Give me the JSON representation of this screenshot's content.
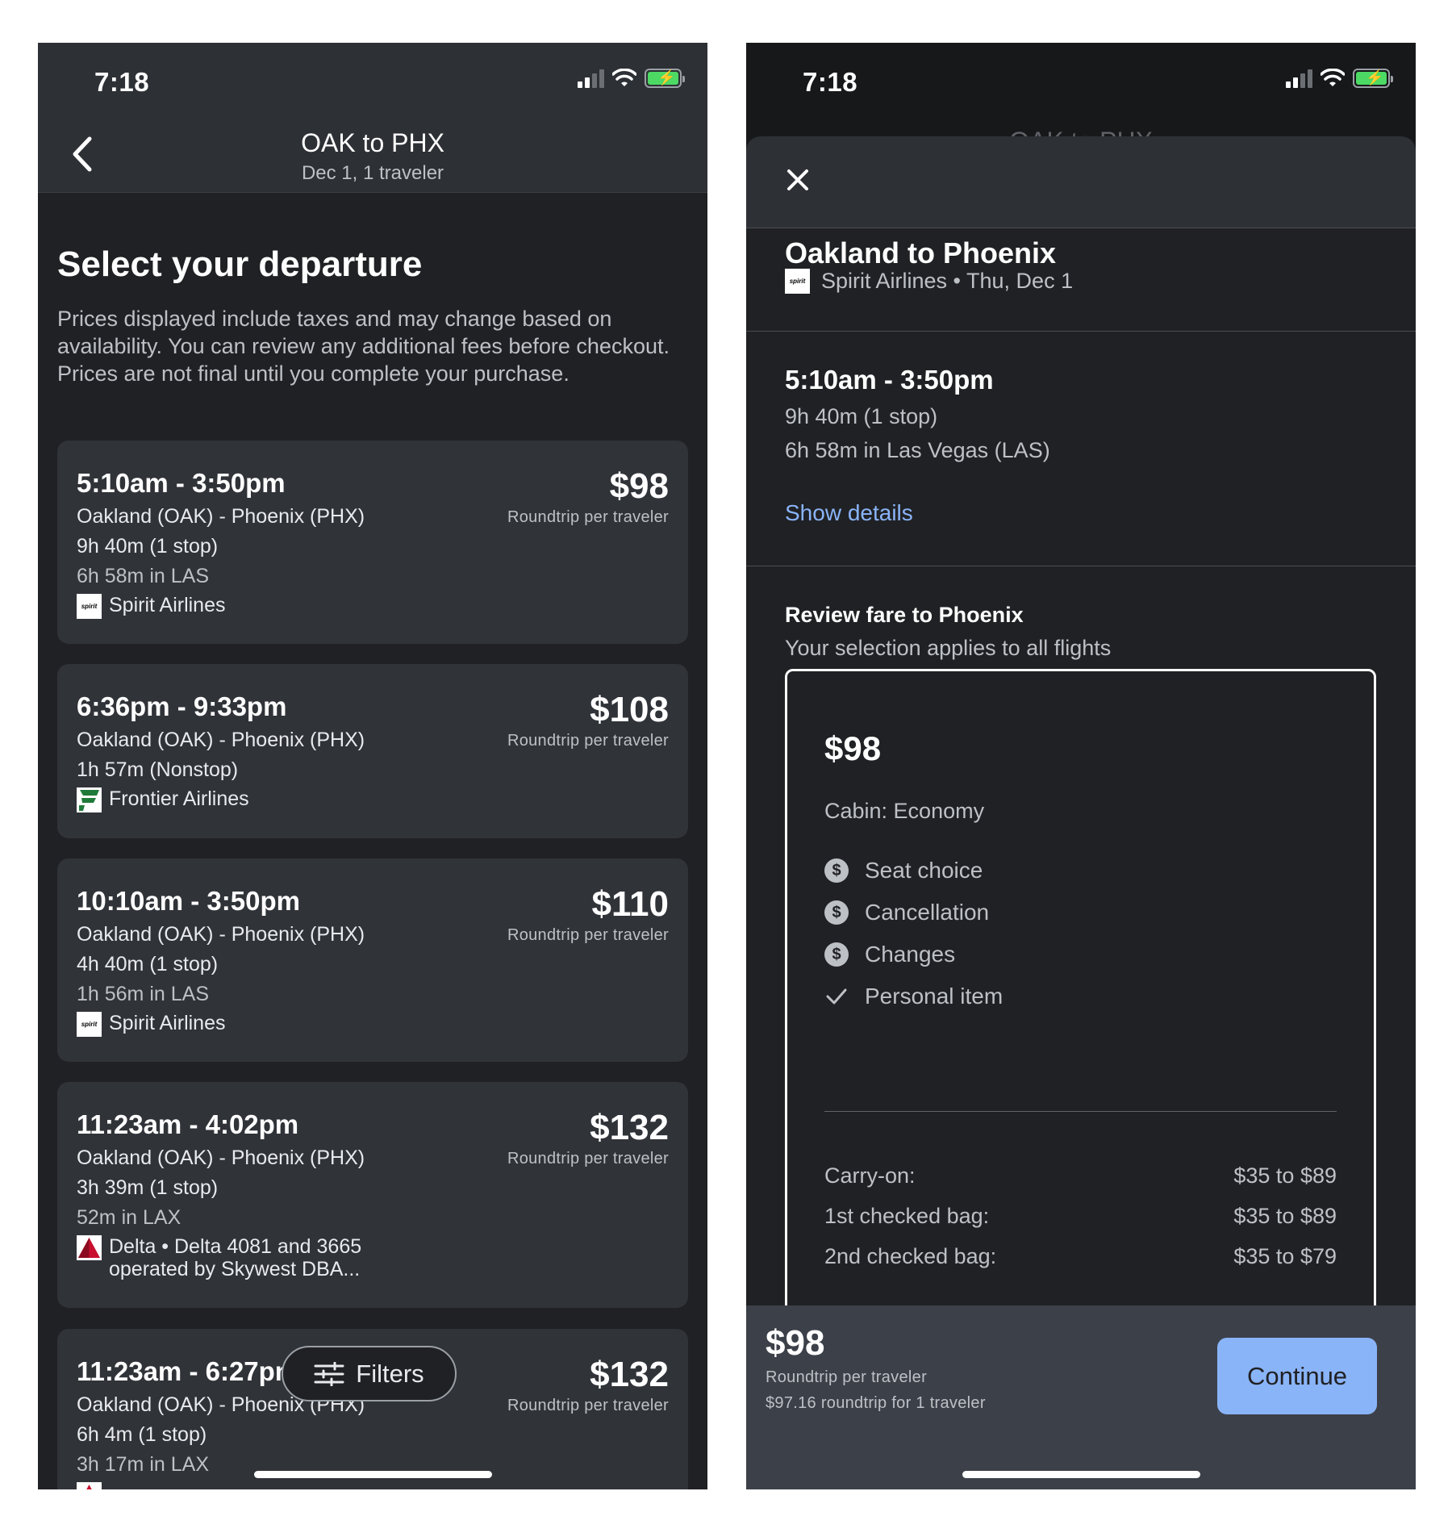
{
  "status_bar": {
    "time": "7:18"
  },
  "left": {
    "header": {
      "title": "OAK to PHX",
      "subtitle": "Dec 1, 1 traveler"
    },
    "heading": "Select your departure",
    "disclaimer": "Prices displayed include taxes and may change based on availability. You can review any additional fees before checkout. Prices are not final until you complete your purchase.",
    "flights": [
      {
        "time": "5:10am - 3:50pm",
        "route": "Oakland (OAK) - Phoenix (PHX)",
        "duration": "9h 40m (1 stop)",
        "layover": "6h 58m in LAS",
        "airline": "Spirit Airlines",
        "airline_detail": "",
        "logo": "spirit-logo",
        "price": "$98",
        "price_note": "Roundtrip per traveler"
      },
      {
        "time": "6:36pm - 9:33pm",
        "route": "Oakland (OAK) - Phoenix (PHX)",
        "duration": "1h 57m (Nonstop)",
        "layover": "",
        "airline": "Frontier Airlines",
        "airline_detail": "",
        "logo": "frontier-logo",
        "price": "$108",
        "price_note": "Roundtrip per traveler"
      },
      {
        "time": "10:10am - 3:50pm",
        "route": "Oakland (OAK) - Phoenix (PHX)",
        "duration": "4h 40m (1 stop)",
        "layover": "1h 56m in LAS",
        "airline": "Spirit Airlines",
        "airline_detail": "",
        "logo": "spirit-logo",
        "price": "$110",
        "price_note": "Roundtrip per traveler"
      },
      {
        "time": "11:23am - 4:02pm",
        "route": "Oakland (OAK) - Phoenix (PHX)",
        "duration": "3h 39m (1 stop)",
        "layover": "52m in LAX",
        "airline": "Delta • Delta 4081 and 3665",
        "airline_detail": "operated by Skywest DBA...",
        "logo": "delta-logo",
        "price": "$132",
        "price_note": "Roundtrip per traveler"
      },
      {
        "time": "11:23am - 6:27pm",
        "route": "Oakland (OAK) - Phoenix (PHX)",
        "duration": "6h 4m (1 stop)",
        "layover": "3h 17m in LAX",
        "airline": "",
        "airline_detail": "",
        "logo": "delta-logo",
        "price": "$132",
        "price_note": "Roundtrip per traveler"
      }
    ],
    "filters_label": "Filters"
  },
  "right": {
    "backdrop_title": "OAK to PHX",
    "route_title": "Oakland to Phoenix",
    "route_sub": "Spirit Airlines • Thu, Dec 1",
    "detail": {
      "time": "5:10am - 3:50pm",
      "duration": "9h 40m (1 stop)",
      "layover": "6h 58m in Las Vegas (LAS)",
      "show_details": "Show details"
    },
    "review": {
      "title": "Review fare to Phoenix",
      "subtitle": "Your selection applies to all flights"
    },
    "fare": {
      "price": "$98",
      "cabin": "Cabin: Economy",
      "features": [
        {
          "label": "Seat choice",
          "icon": "fee-icon"
        },
        {
          "label": "Cancellation",
          "icon": "fee-icon"
        },
        {
          "label": "Changes",
          "icon": "fee-icon"
        },
        {
          "label": "Personal item",
          "icon": "check-icon"
        }
      ],
      "bags": [
        {
          "label": "Carry-on:",
          "value": "$35 to $89"
        },
        {
          "label": "1st checked bag:",
          "value": "$35 to $89"
        },
        {
          "label": "2nd checked bag:",
          "value": "$35 to $79"
        }
      ]
    },
    "bottom": {
      "price": "$98",
      "note1": "Roundtrip per traveler",
      "note2": "$97.16 roundtrip for 1 traveler",
      "continue": "Continue"
    }
  },
  "colors": {
    "background": "#202124",
    "card": "#303338",
    "link": "#8ab4f8",
    "continue_button": "#8ab4f8",
    "battery": "#4cd964"
  }
}
